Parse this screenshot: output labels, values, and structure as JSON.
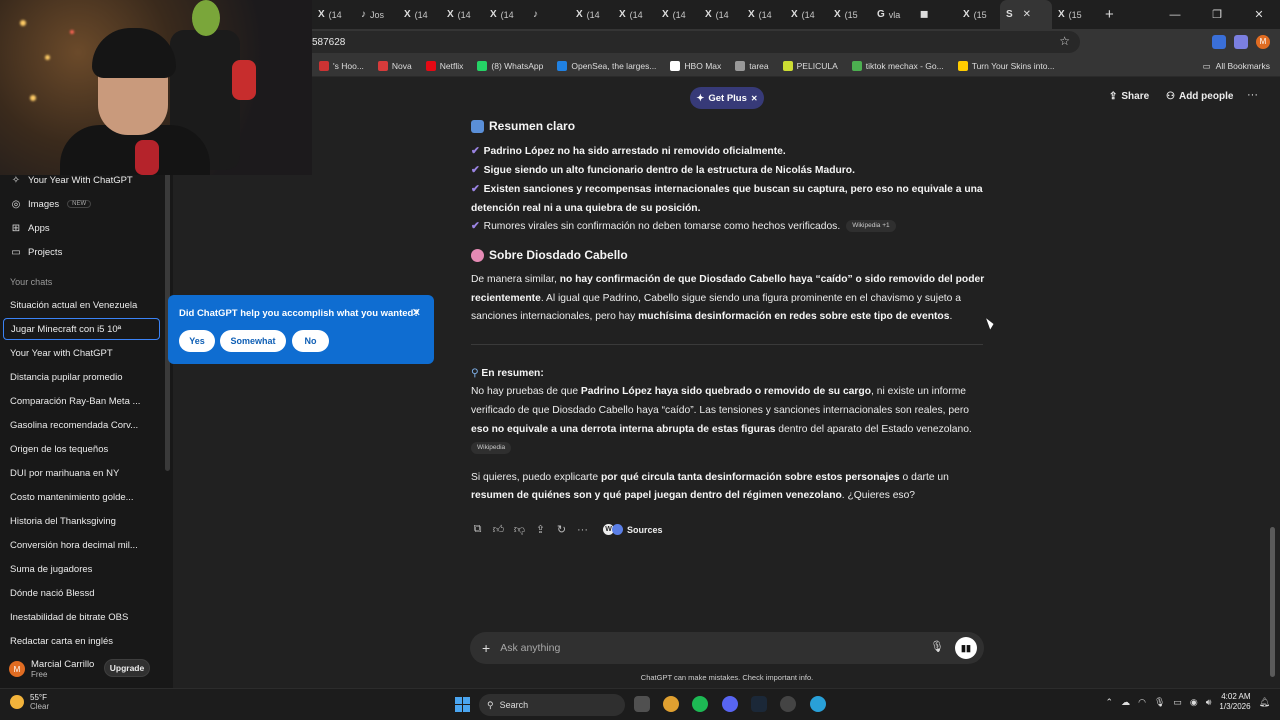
{
  "browser": {
    "tabs": [
      {
        "icon": "x-icon",
        "glyph": "X",
        "label": "(14"
      },
      {
        "icon": "tiktok-icon",
        "glyph": "♪",
        "label": "Jos"
      },
      {
        "icon": "x-icon",
        "glyph": "X",
        "label": "(14"
      },
      {
        "icon": "x-icon",
        "glyph": "X",
        "label": "(14"
      },
      {
        "icon": "x-icon",
        "glyph": "X",
        "label": "(14"
      },
      {
        "icon": "tiktok-icon",
        "glyph": "♪",
        "label": ""
      },
      {
        "icon": "x-icon",
        "glyph": "X",
        "label": "(14"
      },
      {
        "icon": "x-icon",
        "glyph": "X",
        "label": "(14"
      },
      {
        "icon": "x-icon",
        "glyph": "X",
        "label": "(14"
      },
      {
        "icon": "x-icon",
        "glyph": "X",
        "label": "(14"
      },
      {
        "icon": "x-icon",
        "glyph": "X",
        "label": "(14"
      },
      {
        "icon": "x-icon",
        "glyph": "X",
        "label": "(14"
      },
      {
        "icon": "x-icon",
        "glyph": "X",
        "label": "(15"
      },
      {
        "icon": "google-icon",
        "glyph": "G",
        "label": "vla"
      },
      {
        "icon": "extension-icon",
        "glyph": "◼",
        "label": ""
      },
      {
        "icon": "x-icon",
        "glyph": "X",
        "label": "(15"
      },
      {
        "icon": "chatgpt-icon",
        "glyph": "S",
        "label": "",
        "active": true
      },
      {
        "icon": "x-icon",
        "glyph": "X",
        "label": "(15"
      }
    ],
    "url": "587628",
    "bookmarks": [
      {
        "label": "'s Hoo...",
        "color": "#cc3333"
      },
      {
        "label": "Nova",
        "color": "#d63b3b"
      },
      {
        "label": "Netflix",
        "color": "#e50914"
      },
      {
        "label": "(8) WhatsApp",
        "color": "#25d366"
      },
      {
        "label": "OpenSea, the larges...",
        "color": "#2081e2"
      },
      {
        "label": "HBO Max",
        "color": "#ffffff"
      },
      {
        "label": "tarea",
        "color": "#999999"
      },
      {
        "label": "PELICULA",
        "color": "#ccdd33"
      },
      {
        "label": "tiktok mechax - Go...",
        "color": "#4caf50"
      },
      {
        "label": "Turn Your Skins into...",
        "color": "#ffcc00"
      }
    ],
    "all_bookmarks": "All Bookmarks",
    "profile_initial": "M"
  },
  "sidebar": {
    "top_items": [
      {
        "label": "Your Year With ChatGPT",
        "icon": "sparkle-icon",
        "glyph": "✧"
      },
      {
        "label": "Images",
        "icon": "images-icon",
        "glyph": "◎",
        "badge": "NEW"
      },
      {
        "label": "Apps",
        "icon": "apps-icon",
        "glyph": "⊞"
      },
      {
        "label": "Projects",
        "icon": "folder-icon",
        "glyph": "▭"
      }
    ],
    "section_label": "Your chats",
    "chats": [
      "Situación actual en Venezuela",
      "Jugar Minecraft con i5 10ª",
      "Your Year with ChatGPT",
      "Distancia pupilar promedio",
      "Comparación Ray-Ban Meta ...",
      "Gasolina recomendada Corv...",
      "Origen de los tequeños",
      "DUI por marihuana en NY",
      "Costo mantenimiento golde...",
      "Historia del Thanksgiving",
      "Conversión hora decimal mil...",
      "Suma de jugadores",
      "Dónde nació Blessd",
      "Inestabilidad de bitrate OBS",
      "Redactar carta en inglés"
    ],
    "highlighted_chat": 1,
    "user": {
      "initial": "M",
      "name": "Marcial Carrillo",
      "plan": "Free",
      "upgrade": "Upgrade"
    }
  },
  "feedback_popup": {
    "question": "Did ChatGPT help you accomplish what you wanted?",
    "options": [
      "Yes",
      "Somewhat",
      "No"
    ]
  },
  "header": {
    "get_plus": "Get Plus",
    "share": "Share",
    "add_people": "Add people"
  },
  "message": {
    "summary_heading": "Resumen claro",
    "summary_points": [
      {
        "bold": "Padrino López no ha sido arrestado ni removido oficialmente.",
        "rest": ""
      },
      {
        "bold": "Sigue siendo un alto funcionario dentro de la estructura de Nicolás Maduro.",
        "rest": ""
      },
      {
        "bold": "Existen sanciones y recompensas internacionales que buscan su captura, pero eso no equivale a una",
        "rest": ""
      },
      {
        "bold": "detención real ni a una quiebra de su posición.",
        "rest": ""
      },
      {
        "bold": "",
        "rest": "Rumores virales sin confirmación no deben tomarse como hechos verificados."
      }
    ],
    "summary_source": "Wikipedia",
    "summary_source_extra": "+1",
    "cabello_heading": "Sobre Diosdado Cabello",
    "cabello_l1_a": "De manera similar, ",
    "cabello_l1_b": "no hay confirmación de que Diosdado Cabello haya “caído” o sido removido del poder",
    "cabello_l2_a": "recientemente",
    "cabello_l2_b": ". Al igual que Padrino, Cabello sigue siendo una figura prominente en el chavismo y sujeto a",
    "cabello_l3_a": "sanciones internacionales, pero hay ",
    "cabello_l3_b": "muchísima desinformación en redes sobre este tipo de eventos",
    "cabello_l3_c": ".",
    "resumen_heading": "En resumen:",
    "resumen_l1_a": "No hay pruebas de que ",
    "resumen_l1_b": "Padrino López haya sido quebrado o removido de su cargo",
    "resumen_l1_c": ", ni existe un informe",
    "resumen_l2": "verificado de que Diosdado Cabello haya “caído”. Las tensiones y sanciones internacionales son reales, pero",
    "resumen_l3_a": "eso no equivale a una derrota interna abrupta de estas figuras",
    "resumen_l3_b": " dentro del aparato del Estado venezolano.",
    "resumen_source": "Wikipedia",
    "offer_l1_a": "Si quieres, puedo explicarte ",
    "offer_l1_b": "por qué circula tanta desinformación sobre estos personajes",
    "offer_l1_c": " o darte un",
    "offer_l2_a": "resumen de quiénes son y qué papel juegan dentro del régimen venezolano",
    "offer_l2_b": ". ¿Quieres eso?",
    "sources_label": "Sources"
  },
  "composer": {
    "placeholder": "Ask anything",
    "disclaimer": "ChatGPT can make mistakes. Check important info."
  },
  "taskbar": {
    "temp": "55°F",
    "condition": "Clear",
    "search": "Search",
    "time": "4:02 AM",
    "date": "1/3/2026"
  }
}
